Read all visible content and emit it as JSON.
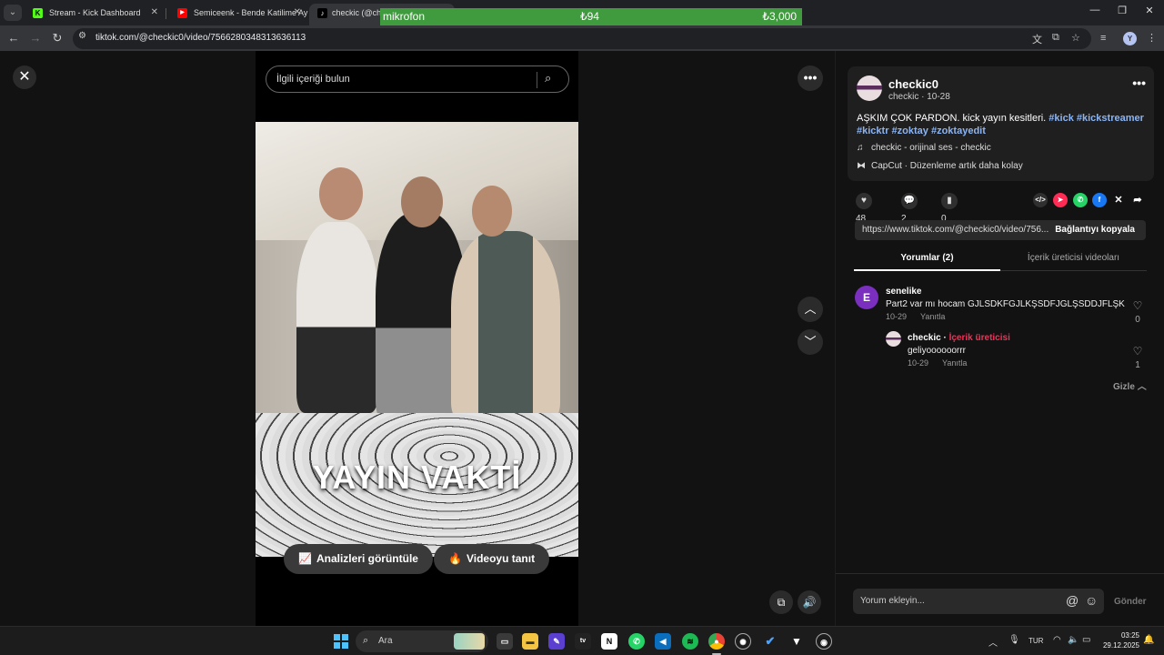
{
  "browser": {
    "tabs": [
      {
        "title": "Stream - Kick Dashboard",
        "icon": "kick-icon",
        "color": "#53fc18"
      },
      {
        "title": "Semiceenk - Bende Katilime Ay",
        "icon": "youtube-icon",
        "color": "#ff0000"
      },
      {
        "title": "checkic (@che",
        "icon": "tiktok-icon",
        "color": "#000000"
      }
    ],
    "overlay": {
      "label": "mikrofon",
      "amount": "₺94",
      "goal": "₺3,000"
    },
    "url": "tiktok.com/@checkic0/video/7566280348313636113"
  },
  "page": {
    "search_placeholder": "İlgili içeriği bulun",
    "video_overlay_text": "YAYIN VAKTİ",
    "analytics_button": "Analizleri görüntüle",
    "promote_button": "Videoyu tanıt"
  },
  "post": {
    "display_name": "checkic0",
    "subline": "checkic · 10-28",
    "caption_text": "AŞKIM ÇOK PARDON. kick yayın kesitleri.",
    "hashtags": [
      "#kick",
      "#kickstreamer",
      "#kicktr",
      "#zoktay",
      "#zoktayedit"
    ],
    "sound": "checkic - orijinal ses - checkic",
    "capcut": "CapCut · Düzenleme artık daha kolay",
    "likes": "48",
    "comments": "2",
    "saves": "0",
    "link": "https://www.tiktok.com/@checkic0/video/756...",
    "copy_link": "Bağlantıyı kopyala"
  },
  "panel_tabs": {
    "comments": "Yorumlar (2)",
    "creator_videos": "İçerik üreticisi videoları"
  },
  "comments": [
    {
      "avatar_letter": "E",
      "user": "senelike",
      "text": "Part2 var mı hocam GJLSDKFGJLKŞSDFJGLŞSDDJFLŞK",
      "date": "10-29",
      "reply": "Yanıtla",
      "likes": "0"
    },
    {
      "user": "checkic",
      "badge": "İçerik üreticisi",
      "separator": " · ",
      "text": "geliyoooooorrr",
      "date": "10-29",
      "reply": "Yanıtla",
      "likes": "1"
    }
  ],
  "hide_label": "Gizle",
  "comment_box": {
    "placeholder": "Yorum ekleyin...",
    "send": "Gönder"
  },
  "taskbar": {
    "search": "Ara",
    "language": "TUR",
    "time": "03:25",
    "date": "29.12.2025"
  },
  "colors": {
    "accent_pink": "#fe2c55",
    "hashtag_blue": "#8cb4f2",
    "overlay_green": "#3f9b3d"
  }
}
